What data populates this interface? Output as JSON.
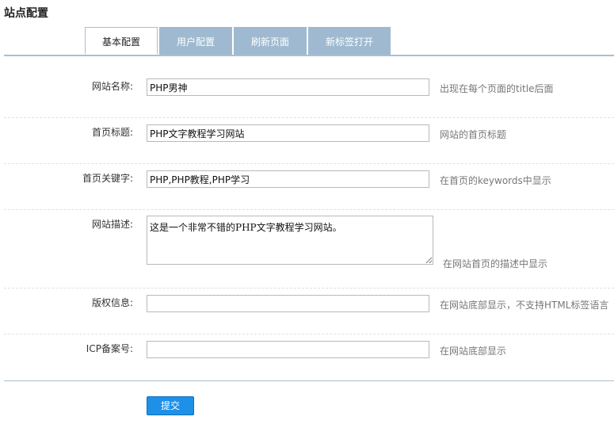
{
  "page": {
    "title": "站点配置"
  },
  "tabs": [
    {
      "label": "基本配置",
      "active": true
    },
    {
      "label": "用户配置",
      "active": false
    },
    {
      "label": "刷新页面",
      "active": false
    },
    {
      "label": "新标签打开",
      "active": false
    }
  ],
  "form": {
    "site_name": {
      "label": "网站名称:",
      "value": "PHP男神",
      "hint": "出现在每个页面的title后面"
    },
    "home_title": {
      "label": "首页标题:",
      "value": "PHP文字教程学习网站",
      "hint": "网站的首页标题"
    },
    "home_keywords": {
      "label": "首页关键字:",
      "value": "PHP,PHP教程,PHP学习",
      "hint": "在首页的keywords中显示"
    },
    "site_desc": {
      "label": "网站描述:",
      "value": "这是一个非常不错的PHP文字教程学习网站。",
      "hint": "在网站首页的描述中显示"
    },
    "copyright": {
      "label": "版权信息:",
      "value": "",
      "hint": "在网站底部显示，不支持HTML标签语言"
    },
    "icp": {
      "label": "ICP备案号:",
      "value": "",
      "hint": "在网站底部显示"
    }
  },
  "submit": {
    "label": "提交"
  },
  "colors": {
    "tab_bg": "#9fbad0",
    "divider": "#a9bfd1",
    "button": "#1e90e8"
  }
}
